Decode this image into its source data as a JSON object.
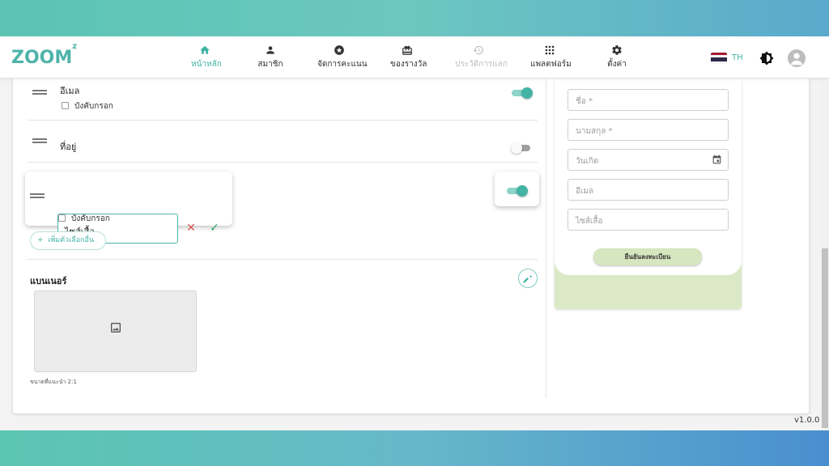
{
  "header": {
    "logo": "ZOOM",
    "logo_sup": "z",
    "nav": [
      {
        "label": "หน้าหลัก",
        "icon": "home-icon",
        "state": "active"
      },
      {
        "label": "สมาชิก",
        "icon": "person-icon",
        "state": "normal"
      },
      {
        "label": "จัดการคะแนน",
        "icon": "star-circle-icon",
        "state": "normal"
      },
      {
        "label": "ของรางวัล",
        "icon": "gift-icon",
        "state": "normal"
      },
      {
        "label": "ประวัติการแลก",
        "icon": "history-icon",
        "state": "disabled"
      },
      {
        "label": "แพลตฟอร์ม",
        "icon": "apps-grid-icon",
        "state": "normal"
      },
      {
        "label": "ตั้งค่า",
        "icon": "gear-icon",
        "state": "normal"
      }
    ],
    "lang": "TH"
  },
  "form_fields": {
    "email": {
      "label": "อีเมล",
      "required_label": "บังคับกรอก",
      "enabled": true
    },
    "address": {
      "label": "ที่อยู่",
      "enabled": false
    },
    "shirt_size": {
      "value": "ไซส์เสื้อ",
      "required_label": "บังคับกรอก",
      "enabled": true
    },
    "add_option_label": "เพิ่มตัวเลือกอื่น"
  },
  "banner": {
    "title": "แบนเนอร์",
    "size_hint": "ขนาดที่แนะนำ 2:1"
  },
  "preview": {
    "fields": [
      {
        "placeholder": "ชื่อ *"
      },
      {
        "placeholder": "นามสกุล *"
      },
      {
        "placeholder": "วันเกิด"
      },
      {
        "placeholder": "อีเมล"
      },
      {
        "placeholder": "ไซส์เสื้อ"
      }
    ],
    "submit_label": "ยืนยันลงทะเบียน"
  },
  "colors": {
    "accent": "#43b3a4",
    "preview_bg": "#dbe9c6"
  },
  "version": "v1.0.0"
}
